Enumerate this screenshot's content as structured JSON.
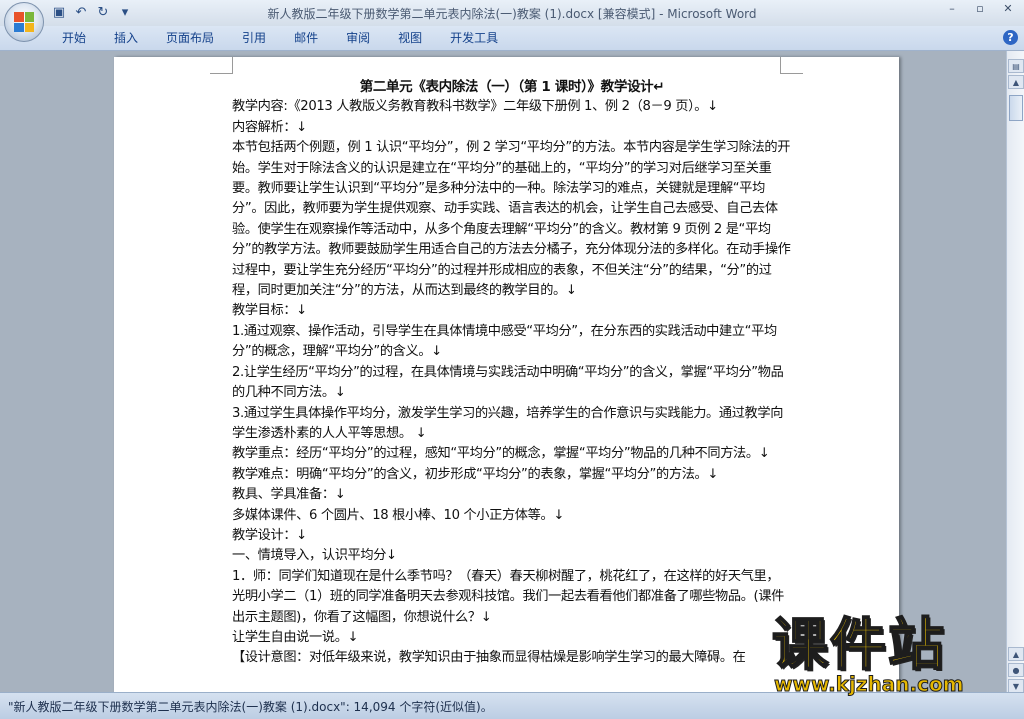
{
  "window": {
    "title": "新人教版二年级下册数学第二单元表内除法(一)教案 (1).docx [兼容模式] - Microsoft Word"
  },
  "quick_access": [
    {
      "icon": "save-icon",
      "glyph": "▣"
    },
    {
      "icon": "undo-icon",
      "glyph": "↶"
    },
    {
      "icon": "redo-icon",
      "glyph": "↻"
    },
    {
      "icon": "customize-icon",
      "glyph": "▾"
    }
  ],
  "window_controls": {
    "minimize": "–",
    "restore": "▫",
    "close": "✕"
  },
  "ribbon": {
    "tabs": [
      "开始",
      "插入",
      "页面布局",
      "引用",
      "邮件",
      "审阅",
      "视图",
      "开发工具"
    ],
    "help": "?"
  },
  "document": {
    "title": "第二单元《表内除法（一）（第 1 课时）》教学设计↵",
    "paragraphs": [
      "教学内容:《2013 人教版义务教育教科书数学》二年级下册例 1、例 2（8－9 页）。↓",
      "内容解析：↓",
      "本节包括两个例题，例 1 认识“平均分”，例 2 学习“平均分”的方法。本节内容是学生学习除法的开始。学生对于除法含义的认识是建立在“平均分”的基础上的，“平均分”的学习对后继学习至关重要。教师要让学生认识到“平均分”是多种分法中的一种。除法学习的难点，关键就是理解“平均分”。因此，教师要为学生提供观察、动手实践、语言表达的机会，让学生自己去感受、自己去体验。使学生在观察操作等活动中，从多个角度去理解“平均分”的含义。教材第 9 页例 2 是“平均分”的教学方法。教师要鼓励学生用适合自己的方法去分橘子，充分体现分法的多样化。在动手操作过程中，要让学生充分经历“平均分”的过程并形成相应的表象，不但关注“分”的结果，“分”的过程，同时更加关注“分”的方法，从而达到最终的教学目的。↓",
      "教学目标：↓",
      "1.通过观察、操作活动，引导学生在具体情境中感受“平均分”，在分东西的实践活动中建立“平均分”的概念，理解“平均分”的含义。↓",
      "2.让学生经历“平均分”的过程，在具体情境与实践活动中明确“平均分”的含义，掌握“平均分”物品的几种不同方法。↓",
      "3.通过学生具体操作平均分，激发学生学习的兴趣，培养学生的合作意识与实践能力。通过教学向学生渗透朴素的人人平等思想。 ↓",
      "教学重点：经历“平均分”的过程，感知“平均分”的概念，掌握“平均分”物品的几种不同方法。↓",
      "教学难点：明确“平均分”的含义，初步形成“平均分”的表象，掌握“平均分”的方法。↓",
      "教具、学具准备：↓",
      "多媒体课件、6 个圆片、18 根小棒、10 个小正方体等。↓",
      "教学设计：↓",
      "一、情境导入，认识平均分↓",
      "1．师：同学们知道现在是什么季节吗？（春天）春天柳树醒了，桃花红了，在这样的好天气里，光明小学二（1）班的同学准备明天去参观科技馆。我们一起去看看他们都准备了哪些物品。(课件出示主题图)，你看了这幅图，你想说什么？↓",
      "让学生自由说一说。↓",
      "【设计意图：对低年级来说，教学知识由于抽象而显得枯燥是影响学生学习的最大障碍。在"
    ]
  },
  "status_bar": {
    "text": "\"新人教版二年级下册数学第二单元表内除法(一)教案 (1).docx\": 14,094 个字符(近似值)。"
  },
  "watermark": {
    "title": "课件站",
    "url": "www.kjzhan.com"
  },
  "colors": {
    "ribbon_text": "#15428b",
    "watermark_yellow": "#f0c400",
    "background": "#a7b2bf"
  }
}
